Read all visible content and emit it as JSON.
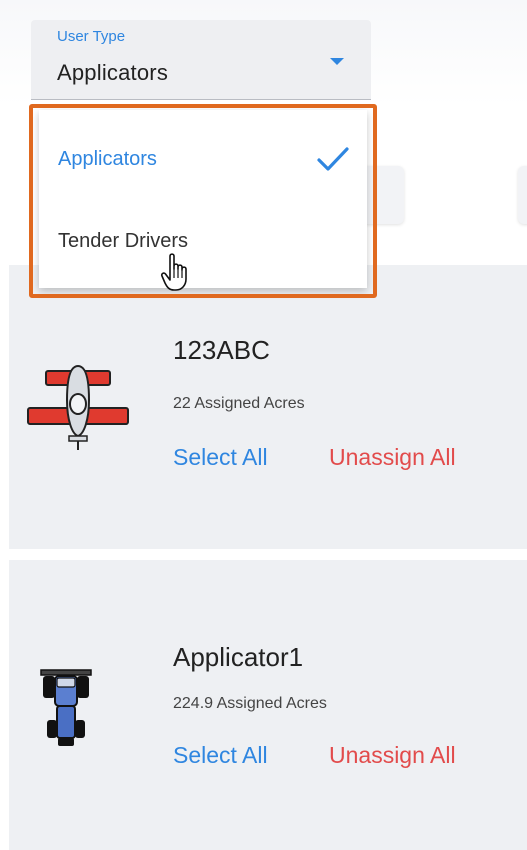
{
  "user_type": {
    "label": "User Type",
    "selected_value": "Applicators"
  },
  "dropdown": {
    "options": [
      {
        "label": "Applicators",
        "selected": true
      },
      {
        "label": "Tender Drivers",
        "selected": false
      }
    ]
  },
  "cards": [
    {
      "name": "123ABC",
      "assigned_acres": "22 Assigned Acres",
      "icon": "airplane-icon",
      "select_all_label": "Select All",
      "unassign_all_label": "Unassign All"
    },
    {
      "name": "Applicator1",
      "assigned_acres": "224.9 Assigned Acres",
      "icon": "sprayer-icon",
      "select_all_label": "Select All",
      "unassign_all_label": "Unassign All"
    }
  ],
  "colors": {
    "accent": "#2f86e0",
    "danger": "#e24b4b",
    "highlight": "#e0691f",
    "card_bg": "#eef0f3"
  },
  "icons": {
    "check": "check-icon",
    "caret": "caret-down-icon",
    "cursor": "hand-pointer-icon"
  }
}
